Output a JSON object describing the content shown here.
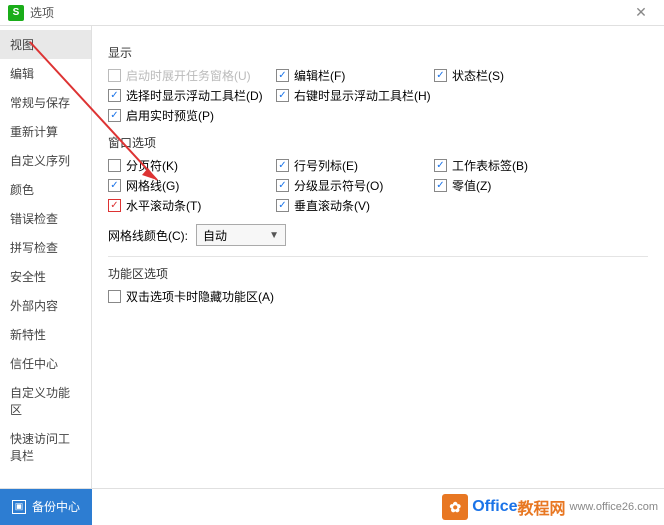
{
  "titlebar": {
    "title": "选项"
  },
  "sidebar": {
    "items": [
      {
        "label": "视图"
      },
      {
        "label": "编辑"
      },
      {
        "label": "常规与保存"
      },
      {
        "label": "重新计算"
      },
      {
        "label": "自定义序列"
      },
      {
        "label": "颜色"
      },
      {
        "label": "错误检查"
      },
      {
        "label": "拼写检查"
      },
      {
        "label": "安全性"
      },
      {
        "label": "外部内容"
      },
      {
        "label": "新特性"
      },
      {
        "label": "信任中心"
      },
      {
        "label": "自定义功能区"
      },
      {
        "label": "快速访问工具栏"
      }
    ]
  },
  "sections": {
    "display": {
      "title": "显示",
      "startup_task_pane": "启动时展开任务窗格(U)",
      "edit_bar": "编辑栏(F)",
      "status_bar": "状态栏(S)",
      "float_toolbar_select": "选择时显示浮动工具栏(D)",
      "float_toolbar_rclick": "右键时显示浮动工具栏(H)",
      "realtime_preview": "启用实时预览(P)"
    },
    "window": {
      "title": "窗口选项",
      "page_break": "分页符(K)",
      "row_col_header": "行号列标(E)",
      "sheet_tabs": "工作表标签(B)",
      "gridlines": "网格线(G)",
      "outline_symbols": "分级显示符号(O)",
      "zero_values": "零值(Z)",
      "h_scrollbar": "水平滚动条(T)",
      "v_scrollbar": "垂直滚动条(V)",
      "grid_color_label": "网格线颜色(C):",
      "grid_color_value": "自动"
    },
    "ribbon": {
      "title": "功能区选项",
      "dbl_click_hide": "双击选项卡时隐藏功能区(A)"
    }
  },
  "footer": {
    "backup_label": "备份中心"
  },
  "logo": {
    "brand": "Office",
    "suffix": "教程网",
    "url": "www.office26.com"
  }
}
